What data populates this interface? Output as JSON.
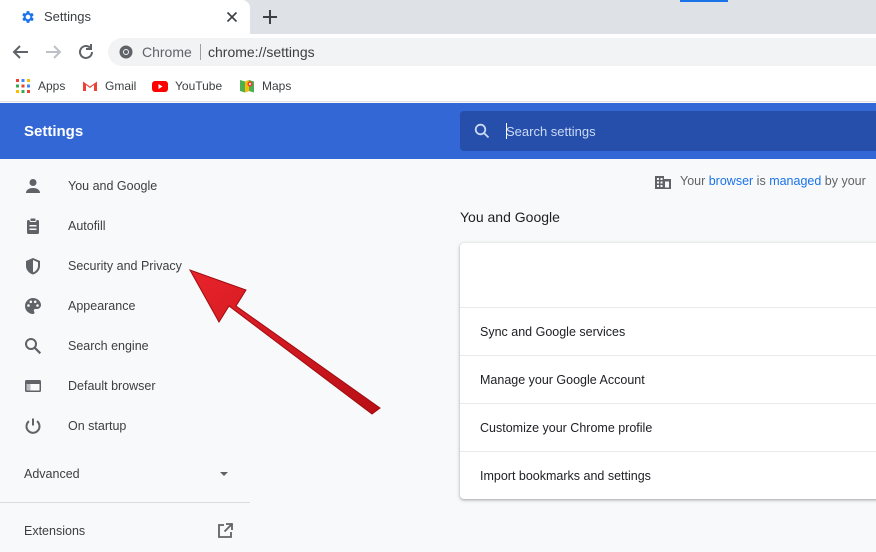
{
  "browser": {
    "tab": {
      "title": "Settings"
    },
    "omnibox": {
      "site_label": "Chrome",
      "url": "chrome://settings"
    },
    "bookmarks": [
      {
        "label": "Apps",
        "icon": "apps-grid-icon"
      },
      {
        "label": "Gmail",
        "icon": "gmail-icon"
      },
      {
        "label": "YouTube",
        "icon": "youtube-icon"
      },
      {
        "label": "Maps",
        "icon": "maps-icon"
      }
    ]
  },
  "header": {
    "title": "Settings",
    "search_placeholder": "Search settings"
  },
  "sidebar": {
    "items": [
      {
        "label": "You and Google",
        "icon": "person-icon"
      },
      {
        "label": "Autofill",
        "icon": "clipboard-icon"
      },
      {
        "label": "Security and Privacy",
        "icon": "shield-icon"
      },
      {
        "label": "Appearance",
        "icon": "palette-icon"
      },
      {
        "label": "Search engine",
        "icon": "search-icon"
      },
      {
        "label": "Default browser",
        "icon": "browser-window-icon"
      },
      {
        "label": "On startup",
        "icon": "power-icon"
      }
    ],
    "advanced_label": "Advanced",
    "extensions_label": "Extensions"
  },
  "main": {
    "managed_notice": {
      "prefix": "Your ",
      "link1": "browser",
      "middle": " is ",
      "link2": "managed",
      "suffix": " by your"
    },
    "section_title": "You and Google",
    "card_rows": [
      "Sync and Google services",
      "Manage your Google Account",
      "Customize your Chrome profile",
      "Import bookmarks and settings"
    ]
  },
  "colors": {
    "header_blue": "#3367d6",
    "search_blue": "#254faa",
    "link_blue": "#1a73e8",
    "annotation_red": "#d9151c"
  }
}
